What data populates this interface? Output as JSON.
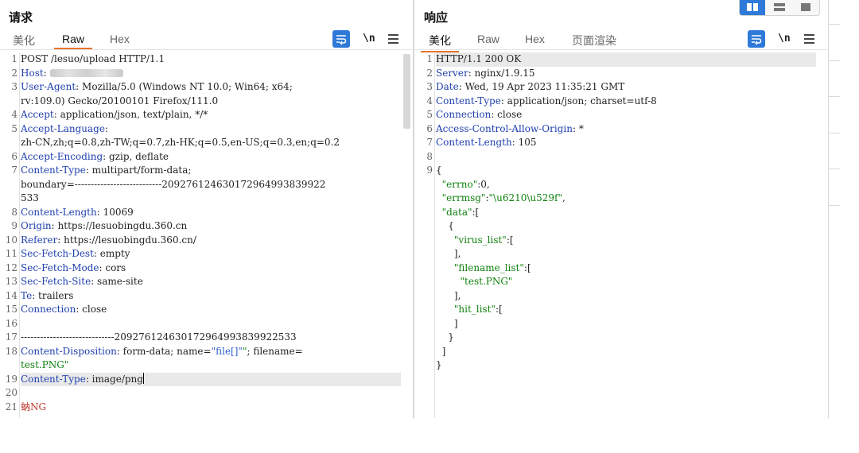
{
  "request": {
    "title": "请求",
    "tabs": [
      "美化",
      "Raw",
      "Hex"
    ],
    "active_tab": "Raw",
    "newline_label": "\\n",
    "gutter": [
      "1",
      "2",
      "3",
      "",
      "4",
      "5",
      "",
      "6",
      "7",
      "",
      "",
      "8",
      "9",
      "10",
      "11",
      "12",
      "13",
      "14",
      "15",
      "16",
      "17",
      "18",
      "",
      "19",
      "20",
      "21"
    ]
  },
  "response": {
    "title": "响应",
    "tabs": [
      "美化",
      "Raw",
      "Hex",
      "页面渲染"
    ],
    "active_tab": "美化",
    "newline_label": "\\n",
    "gutter": [
      "1",
      "2",
      "3",
      "4",
      "5",
      "6",
      "7",
      "8",
      "9",
      "",
      "",
      "",
      "",
      "",
      "",
      "",
      "",
      "",
      "",
      "",
      "",
      "",
      ""
    ]
  },
  "req_lines": [
    {
      "plain": "POST /lesuo/upload HTTP/1.1"
    },
    {
      "key": "Host",
      "sep": ": ",
      "value": "",
      "blurred": true
    },
    {
      "key": "User-Agent",
      "sep": ": ",
      "value": "Mozilla/5.0 (Windows NT 10.0; Win64; x64;"
    },
    {
      "plain": "rv:109.0) Gecko/20100101 Firefox/111.0"
    },
    {
      "key": "Accept",
      "sep": ": ",
      "value": "application/json, text/plain, */*"
    },
    {
      "key": "Accept-Language",
      "sep": ":",
      "value": ""
    },
    {
      "plain": "zh-CN,zh;q=0.8,zh-TW;q=0.7,zh-HK;q=0.5,en-US;q=0.3,en;q=0.2"
    },
    {
      "key": "Accept-Encoding",
      "sep": ": ",
      "value": "gzip, deflate"
    },
    {
      "key": "Content-Type",
      "sep": ": ",
      "value": "multipart/form-data;"
    },
    {
      "plain": "boundary=---------------------------209276124630172964993839922"
    },
    {
      "plain": "533"
    },
    {
      "key": "Content-Length",
      "sep": ": ",
      "value": "10069"
    },
    {
      "key": "Origin",
      "sep": ": ",
      "value": "https://lesuobingdu.360.cn"
    },
    {
      "key": "Referer",
      "sep": ": ",
      "value": "https://lesuobingdu.360.cn/"
    },
    {
      "key": "Sec-Fetch-Dest",
      "sep": ": ",
      "value": "empty"
    },
    {
      "key": "Sec-Fetch-Mode",
      "sep": ": ",
      "value": "cors"
    },
    {
      "key": "Sec-Fetch-Site",
      "sep": ": ",
      "value": "same-site"
    },
    {
      "key": "Te",
      "sep": ": ",
      "value": "trailers"
    },
    {
      "key": "Connection",
      "sep": ": ",
      "value": "close"
    },
    {
      "plain": ""
    },
    {
      "plain": "-----------------------------209276124630172964993839922533"
    },
    {
      "key": "Content-Disposition",
      "sep": ": ",
      "value": "form-data; name=",
      "str1": "\"file[]\"",
      "value2": "; filename=",
      "str2": "\""
    },
    {
      "strline": "test.PNG\""
    },
    {
      "key": "Content-Type",
      "sep": ": ",
      "value": "image/png",
      "caret": true,
      "highlight": true
    },
    {
      "plain": ""
    },
    {
      "red": "蚋NG"
    }
  ],
  "res_lines": [
    {
      "plain": "HTTP/1.1 200 OK",
      "highlight": true
    },
    {
      "key": "Server",
      "sep": ": ",
      "value": "nginx/1.9.15"
    },
    {
      "key": "Date",
      "sep": ": ",
      "value": "Wed, 19 Apr 2023 11:35:21 GMT"
    },
    {
      "key": "Content-Type",
      "sep": ": ",
      "value": "application/json; charset=utf-8"
    },
    {
      "key": "Connection",
      "sep": ": ",
      "value": "close"
    },
    {
      "key": "Access-Control-Allow-Origin",
      "sep": ": ",
      "value": "*"
    },
    {
      "key": "Content-Length",
      "sep": ": ",
      "value": "105"
    },
    {
      "plain": ""
    },
    {
      "plain": "{"
    },
    {
      "indent": "  ",
      "str1": "\"errno\"",
      "value": ":0,"
    },
    {
      "indent": "  ",
      "str1": "\"errmsg\"",
      "value": ":",
      "str2": "\"\\u6210\\u529f\"",
      "value2": ","
    },
    {
      "indent": "  ",
      "str1": "\"data\"",
      "value": ":["
    },
    {
      "indent": "    ",
      "value": "{"
    },
    {
      "indent": "      ",
      "str1": "\"virus_list\"",
      "value": ":["
    },
    {
      "indent": "      ",
      "value": "],"
    },
    {
      "indent": "      ",
      "str1": "\"filename_list\"",
      "value": ":["
    },
    {
      "indent": "        ",
      "str1": "\"test.PNG\""
    },
    {
      "indent": "      ",
      "value": "],"
    },
    {
      "indent": "      ",
      "str1": "\"hit_list\"",
      "value": ":["
    },
    {
      "indent": "      ",
      "value": "]"
    },
    {
      "indent": "    ",
      "value": "}"
    },
    {
      "indent": "  ",
      "value": "]"
    },
    {
      "plain": "}"
    }
  ]
}
